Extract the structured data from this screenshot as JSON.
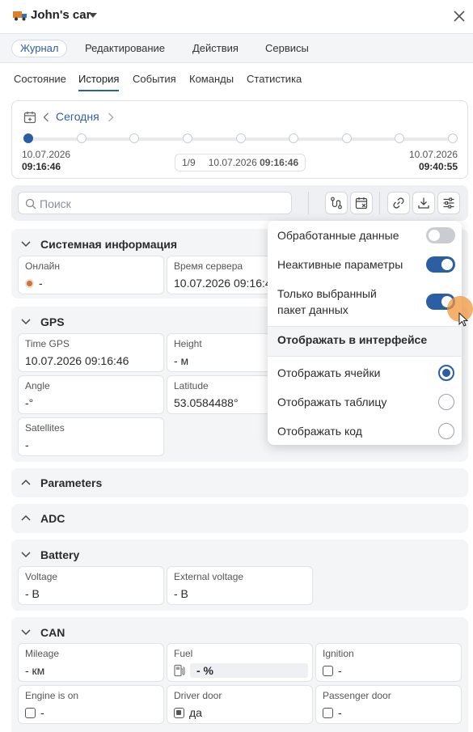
{
  "header": {
    "title": "John's car"
  },
  "main_tabs": [
    "Журнал",
    "Редактирование",
    "Действия",
    "Сервисы"
  ],
  "sub_tabs": [
    "Состояние",
    "История",
    "События",
    "Команды",
    "Статистика"
  ],
  "timeline": {
    "date_label": "Сегодня",
    "start_date": "10.07.2026",
    "start_time": "09:16:46",
    "end_date": "10.07.2026",
    "end_time": "09:40:55",
    "counter": "1/9",
    "current_date": "10.07.2026",
    "current_time": "09:16:46"
  },
  "toolbar": {
    "search_placeholder": "Поиск"
  },
  "sections": {
    "system": {
      "title": "Системная информация",
      "online_label": "Онлайн",
      "online_value": "-",
      "server_time_label": "Время сервера",
      "server_time_value": "10.07.2026 09:16:46"
    },
    "gps": {
      "title": "GPS",
      "time_label": "Time GPS",
      "time_value": "10.07.2026 09:16:46",
      "height_label": "Height",
      "height_value": "- м",
      "angle_label": "Angle",
      "angle_value": "-°",
      "latitude_label": "Latitude",
      "latitude_value": "53.0584488°",
      "satellites_label": "Satellites",
      "satellites_value": "-"
    },
    "parameters": {
      "title": "Parameters"
    },
    "adc": {
      "title": "ADC"
    },
    "battery": {
      "title": "Battery",
      "voltage_label": "Voltage",
      "voltage_value": "- В",
      "ext_voltage_label": "External voltage",
      "ext_voltage_value": "- В"
    },
    "can": {
      "title": "CAN",
      "mileage_label": "Mileage",
      "mileage_value": "- км",
      "fuel_label": "Fuel",
      "fuel_value": "- %",
      "ignition_label": "Ignition",
      "ignition_value": "-",
      "engine_label": "Engine is on",
      "engine_value": "-",
      "driver_door_label": "Driver door",
      "driver_door_value": "да",
      "passenger_door_label": "Passenger door",
      "passenger_door_value": "-"
    }
  },
  "dropdown": {
    "processed": {
      "label": "Обработанные данные",
      "enabled": false
    },
    "inactive": {
      "label": "Неактивные параметры",
      "enabled": true
    },
    "selected_packet": {
      "label_line1": "Только выбранный",
      "label_line2": "пакет данных",
      "enabled": true
    },
    "display_heading": "Отображать в интерфейсе",
    "display_options": [
      "Отображать ячейки",
      "Отображать таблицу",
      "Отображать код"
    ],
    "display_selected": "Отображать ячейки"
  },
  "colors": {
    "accent": "#2b5ea3",
    "status_online": "#c8743f"
  }
}
